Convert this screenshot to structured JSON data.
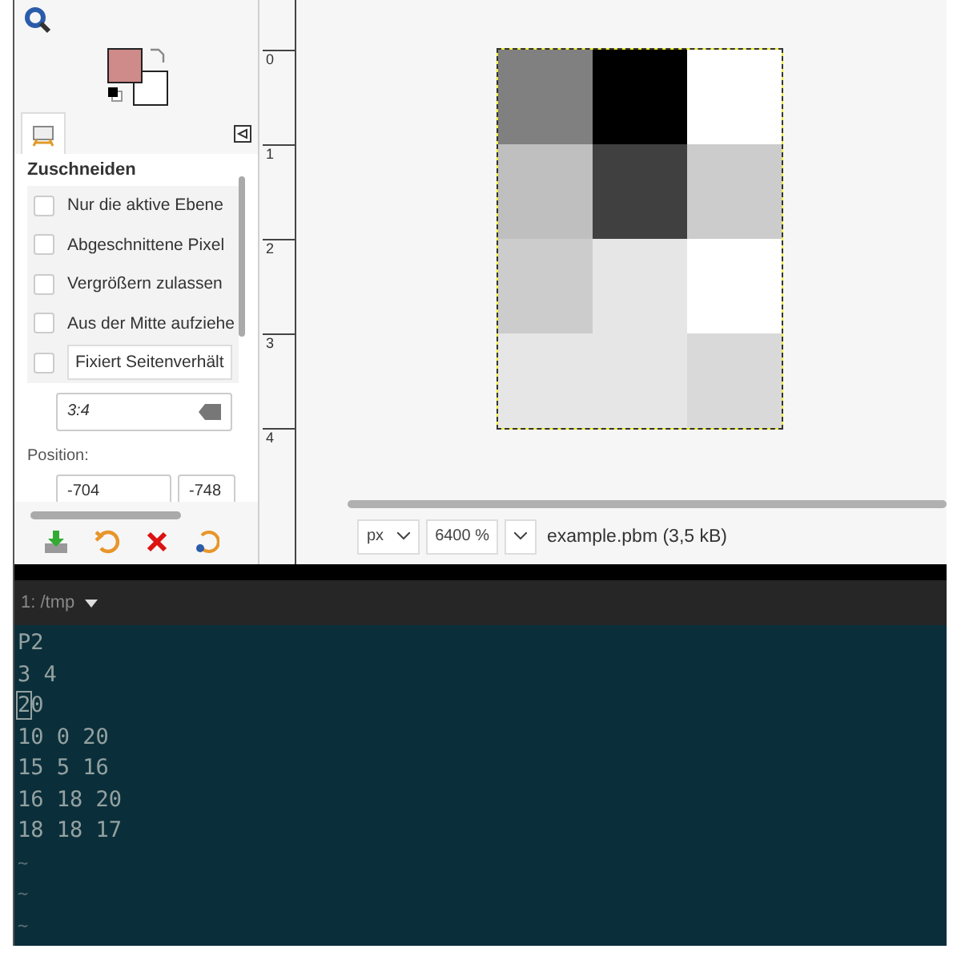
{
  "toolbox": {
    "swatches": [
      {
        "kind": "foreground",
        "color": "#cf8a8a"
      },
      {
        "kind": "background",
        "color": "#ffffff"
      }
    ]
  },
  "tool_options": {
    "title": "Zuschneiden",
    "options": [
      {
        "kind": "checkbox",
        "label": "Nur die aktive Ebene",
        "checked": false
      },
      {
        "kind": "checkbox",
        "label": "Abgeschnittene Pixel",
        "checked": false
      },
      {
        "kind": "checkbox",
        "label": "Vergrößern zulassen",
        "checked": false
      },
      {
        "kind": "checkbox",
        "label": "Aus der Mitte aufziehe",
        "checked": false
      },
      {
        "kind": "dropdown",
        "label": "Fixiert",
        "value": "Seitenverhält",
        "checked": false
      }
    ],
    "ratio_field": {
      "value": "3:4"
    },
    "position_label": "Position:",
    "position_fields": [
      {
        "value": "-704"
      },
      {
        "value": "-748"
      }
    ]
  },
  "ruler": [
    "0",
    "1",
    "2",
    "3",
    "4"
  ],
  "image": {
    "rows": [
      [
        {
          "color": "#808080"
        },
        {
          "color": "#000000"
        },
        {
          "color": "#ffffff"
        }
      ],
      [
        {
          "color": "#bfbfbf"
        },
        {
          "color": "#404040"
        },
        {
          "color": "#cccccc"
        }
      ],
      [
        {
          "color": "#cccccc"
        },
        {
          "color": "#e6e6e6"
        },
        {
          "color": "#ffffff"
        }
      ],
      [
        {
          "color": "#e6e6e6"
        },
        {
          "color": "#e6e6e6"
        },
        {
          "color": "#d9d9d9"
        }
      ]
    ]
  },
  "status_bar": {
    "unit": "px",
    "zoom": "6400 %",
    "file": "example.pbm (3,5 kB)"
  },
  "terminal": {
    "tab": "1: /tmp",
    "lines": [
      {
        "kind": "text",
        "text": "P2",
        "cursor": false
      },
      {
        "kind": "text",
        "text": "3 4",
        "cursor": false
      },
      {
        "kind": "text",
        "text": "20",
        "cursor": true
      },
      {
        "kind": "text",
        "text": "10 0 20",
        "cursor": false
      },
      {
        "kind": "text",
        "text": "15 5 16",
        "cursor": false
      },
      {
        "kind": "text",
        "text": "16 18 20",
        "cursor": false
      },
      {
        "kind": "text",
        "text": "18 18 17",
        "cursor": false
      },
      {
        "kind": "filler",
        "text": "~"
      },
      {
        "kind": "filler",
        "text": "~"
      },
      {
        "kind": "filler",
        "text": "~"
      }
    ]
  }
}
